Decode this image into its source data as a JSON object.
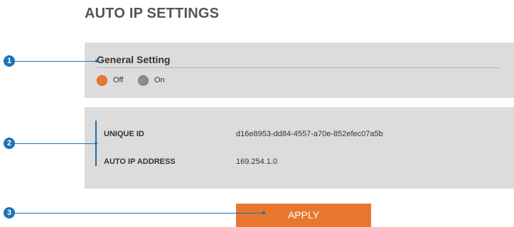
{
  "page": {
    "title": "AUTO IP SETTINGS"
  },
  "general_setting": {
    "heading": "General Setting",
    "options": [
      {
        "label": "Off",
        "selected": true
      },
      {
        "label": "On",
        "selected": false
      }
    ]
  },
  "info": {
    "unique_id_label": "UNIQUE ID",
    "unique_id_value": "d16e8953-dd84-4557-a70e-852efec07a5b",
    "auto_ip_label": "AUTO IP ADDRESS",
    "auto_ip_value": "169.254.1.0"
  },
  "actions": {
    "apply_label": "APPLY"
  },
  "callouts": [
    "1",
    "2",
    "3"
  ],
  "colors": {
    "accent": "#e8772e",
    "callout": "#1a73b9",
    "panel": "#dcdcdc"
  }
}
